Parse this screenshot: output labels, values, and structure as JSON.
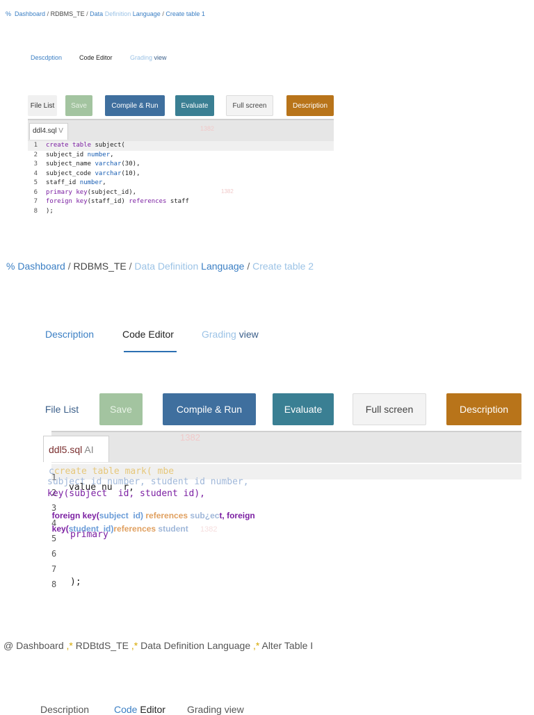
{
  "section1": {
    "breadcrumb": {
      "home_glyph": "%",
      "dashboard": "Dashboard",
      "sep": "/",
      "course": "RDBMS_TE",
      "topic_a": "Data",
      "topic_b": "Definition",
      "topic_c": "Language",
      "page": "Create table 1"
    },
    "tabs": {
      "description": "Descdption",
      "code_editor": "Code Editor",
      "grading_a": "Grading",
      "grading_b": "view"
    },
    "toolbar": {
      "file_list": "File List",
      "save": "Save",
      "compile": "Compile & Run",
      "evaluate": "Evaluate",
      "full_screen": "Full screen",
      "description": "Description"
    },
    "editor": {
      "file_name": "ddl4.sql",
      "file_extra": "V",
      "ghost": "1382",
      "ghost2": "1382",
      "lines": [
        {
          "n": "1",
          "text": "create table subject("
        },
        {
          "n": "2",
          "text": "subject_id number,"
        },
        {
          "n": "3",
          "text": "subject_name varchar(30),"
        },
        {
          "n": "4",
          "text": "subject_code varchar(10),"
        },
        {
          "n": "5",
          "text": "staff_id number,"
        },
        {
          "n": "6",
          "text": "primary key(subject_id),"
        },
        {
          "n": "7",
          "text": "foreign key(staff_id) references staff"
        },
        {
          "n": "8",
          "text": ");"
        }
      ]
    }
  },
  "section2": {
    "breadcrumb": {
      "home_glyph": "%",
      "dashboard": "Dashboard",
      "sep": "/",
      "course": "RDBMS_TE",
      "topic_a": "Data",
      "topic_b": "Definition",
      "topic_c": "Language",
      "page": "Create table 2"
    },
    "tabs": {
      "description": "Description",
      "code_editor": "Code Editor",
      "grading_a": "Grading",
      "grading_b": "view"
    },
    "toolbar": {
      "file_list": "File List",
      "save": "Save",
      "compile": "Compile & Run",
      "evaluate": "Evaluate",
      "full_screen": "Full screen",
      "description": "Description"
    },
    "editor": {
      "file_name": "ddl5.sql",
      "file_extra": "AI",
      "ghost": "1382",
      "ghost2": "1382",
      "gutter": [
        "1",
        "2",
        "3",
        "4",
        "5",
        "6",
        "7",
        "8"
      ],
      "line1_overlay": "create table mark( mbe",
      "line2_overlay": "subject id number, student id number,",
      "line2_text": "value nu  r,",
      "line3_overlay": "key(subject  id, student id),",
      "line4_a": "foreign key(",
      "line4_b": "subject  id)",
      "line4_c": " references ",
      "line4_d": "sub¿ec",
      "line4_e": "t, foreign",
      "line5_a": "key(",
      "line5_b": "student  id)",
      "line5_c": "references ",
      "line5_d": "student",
      "line5_text": "primary",
      "line8_text": ");"
    }
  },
  "section3": {
    "breadcrumb": {
      "home_glyph": "@",
      "dashboard": "Dashboard",
      "sep": ",*",
      "course": "RDBtdS_TE",
      "topic": "Data Definition Language",
      "page": "Alter Table I"
    },
    "tabs": {
      "description": "Description",
      "code_a": "Code",
      "code_b": "Editor",
      "grading": "Grading view"
    }
  }
}
